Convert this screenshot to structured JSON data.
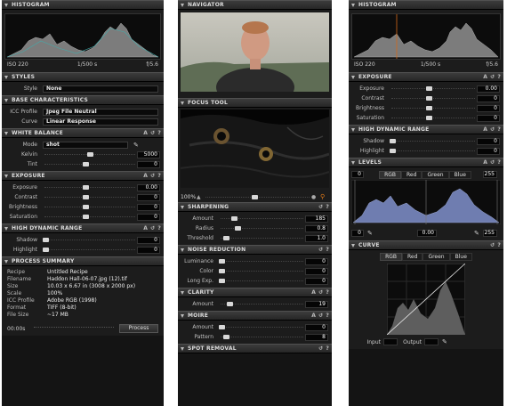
{
  "col1": {
    "histogram": {
      "title": "HISTOGRAM",
      "iso": "ISO 220",
      "shutter": "1/500 s",
      "aperture": "f/5.6"
    },
    "styles": {
      "title": "STYLES",
      "style_label": "Style",
      "style_value": "None"
    },
    "base": {
      "title": "BASE CHARACTERISTICS",
      "icc_label": "ICC Profile",
      "icc_value": "Jpeg File Neutral",
      "curve_label": "Curve",
      "curve_value": "Linear Response"
    },
    "wb": {
      "title": "WHITE BALANCE",
      "mode_label": "Mode",
      "mode_value": "shot",
      "kelvin_label": "Kelvin",
      "kelvin_value": "5000",
      "kelvin_level": 0.5,
      "tint_label": "Tint",
      "tint_value": "0",
      "tint_level": 0.45
    },
    "exposure": {
      "title": "EXPOSURE",
      "rows": [
        {
          "label": "Exposure",
          "value": "0.00",
          "level": 0.45
        },
        {
          "label": "Contrast",
          "value": "0",
          "level": 0.45
        },
        {
          "label": "Brightness",
          "value": "0",
          "level": 0.45
        },
        {
          "label": "Saturation",
          "value": "0",
          "level": 0.45
        }
      ]
    },
    "hdr": {
      "title": "HIGH DYNAMIC RANGE",
      "rows": [
        {
          "label": "Shadow",
          "value": "0",
          "level": 0.0
        },
        {
          "label": "Highlight",
          "value": "0",
          "level": 0.0
        }
      ]
    },
    "summary": {
      "title": "PROCESS SUMMARY",
      "rows": [
        {
          "k": "Recipe",
          "v": "Untitled Recipe"
        },
        {
          "k": "Filename",
          "v": "Haddon Hall-06-07.jpg (12).tif"
        },
        {
          "k": "Size",
          "v": "10.03 x 6.67 in (3008 x 2000 px)"
        },
        {
          "k": "Scale",
          "v": "100%"
        },
        {
          "k": "ICC Profile",
          "v": "Adobe RGB (1998)"
        },
        {
          "k": "Format",
          "v": "TIFF (8-bit)"
        },
        {
          "k": "File Size",
          "v": "~17 MB"
        }
      ],
      "time": "00:00s",
      "process_button": "Process"
    }
  },
  "col2": {
    "navigator": {
      "title": "NAVIGATOR"
    },
    "focus": {
      "title": "FOCUS TOOL",
      "zoom": "100%"
    },
    "sharpening": {
      "title": "SHARPENING",
      "rows": [
        {
          "label": "Amount",
          "value": "185",
          "level": 0.15
        },
        {
          "label": "Radius",
          "value": "0.8",
          "level": 0.2
        },
        {
          "label": "Threshold",
          "value": "1.0",
          "level": 0.05
        }
      ]
    },
    "noise": {
      "title": "NOISE REDUCTION",
      "rows": [
        {
          "label": "Luminance",
          "value": "0",
          "level": 0.0
        },
        {
          "label": "Color",
          "value": "0",
          "level": 0.0
        },
        {
          "label": "Long Exp.",
          "value": "0",
          "level": 0.0
        }
      ]
    },
    "clarity": {
      "title": "CLARITY",
      "rows": [
        {
          "label": "Amount",
          "value": "19",
          "level": 0.1
        }
      ]
    },
    "moire": {
      "title": "MOIRE",
      "rows": [
        {
          "label": "Amount",
          "value": "0",
          "level": 0.0
        },
        {
          "label": "Pattern",
          "value": "8",
          "level": 0.05
        }
      ]
    },
    "spot": {
      "title": "SPOT REMOVAL"
    }
  },
  "col3": {
    "histogram": {
      "title": "HISTOGRAM",
      "iso": "ISO 220",
      "shutter": "1/500 s",
      "aperture": "f/5.6"
    },
    "exposure": {
      "title": "EXPOSURE",
      "rows": [
        {
          "label": "Exposure",
          "value": "0.00",
          "level": 0.45
        },
        {
          "label": "Contrast",
          "value": "0",
          "level": 0.45
        },
        {
          "label": "Brightness",
          "value": "0",
          "level": 0.45
        },
        {
          "label": "Saturation",
          "value": "0",
          "level": 0.45
        }
      ]
    },
    "hdr": {
      "title": "HIGH DYNAMIC RANGE",
      "rows": [
        {
          "label": "Shadow",
          "value": "0",
          "level": 0.0
        },
        {
          "label": "Highlight",
          "value": "0",
          "level": 0.0
        }
      ]
    },
    "levels": {
      "title": "LEVELS",
      "input_low": "0",
      "input_high": "255",
      "tabs": [
        "RGB",
        "Red",
        "Green",
        "Blue"
      ],
      "output_low": "0",
      "gamma": "0.00",
      "output_high": "255"
    },
    "curve": {
      "title": "CURVE",
      "tabs": [
        "RGB",
        "Red",
        "Green",
        "Blue"
      ],
      "input_label": "Input",
      "output_label": "Output"
    }
  }
}
